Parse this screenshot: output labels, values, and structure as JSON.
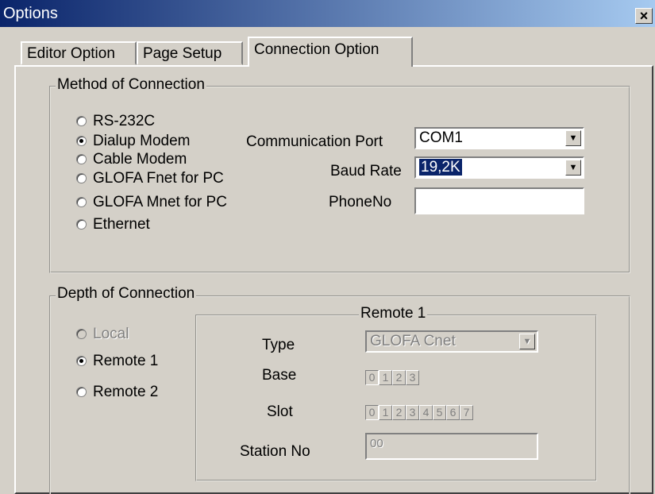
{
  "window": {
    "title": "Options",
    "close_label": "×"
  },
  "tabs": [
    {
      "label": "Editor Option"
    },
    {
      "label": "Page Setup"
    },
    {
      "label": "Connection Option"
    }
  ],
  "method_group": {
    "legend": "Method of Connection",
    "options": [
      {
        "label": "RS-232C",
        "checked": false
      },
      {
        "label": "Dialup Modem",
        "checked": true
      },
      {
        "label": "Cable Modem",
        "checked": false
      },
      {
        "label": "GLOFA Fnet for PC",
        "checked": false
      },
      {
        "label": "GLOFA Mnet for PC",
        "checked": false
      },
      {
        "label": "Ethernet",
        "checked": false
      }
    ],
    "comm_port_label": "Communication Port",
    "comm_port_value": "COM1",
    "baud_rate_label": "Baud Rate",
    "baud_rate_value": "19,2K",
    "phone_label": "PhoneNo",
    "phone_value": ""
  },
  "depth_group": {
    "legend": "Depth of Connection",
    "options": [
      {
        "label": "Local",
        "checked": false,
        "disabled": true
      },
      {
        "label": "Remote 1",
        "checked": true,
        "disabled": false
      },
      {
        "label": "Remote 2",
        "checked": false,
        "disabled": false
      }
    ],
    "remote": {
      "legend": "Remote 1",
      "type_label": "Type",
      "type_value": "GLOFA Cnet",
      "base_label": "Base",
      "base_values": [
        "0",
        "1",
        "2",
        "3"
      ],
      "base_selected": "0",
      "slot_label": "Slot",
      "slot_values": [
        "0",
        "1",
        "2",
        "3",
        "4",
        "5",
        "6",
        "7"
      ],
      "slot_selected": "0",
      "station_label": "Station No",
      "station_value": "00"
    }
  }
}
